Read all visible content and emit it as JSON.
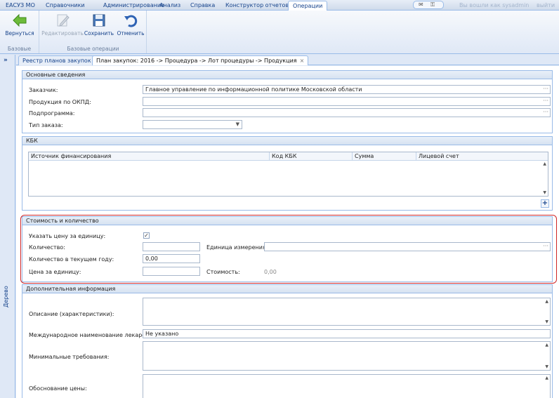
{
  "menu": {
    "items": [
      "ЕАСУЗ МО",
      "Справочники",
      "Администрирование",
      "Анализ",
      "Справка",
      "Конструктор отчетов",
      "Операции"
    ],
    "active": "Операции",
    "user_text": "Вы вошли как sysadmin",
    "logout": "выйти"
  },
  "ribbon": {
    "btn_back": "Вернуться",
    "btn_edit": "Редактировать",
    "btn_save": "Сохранить",
    "btn_cancel": "Отменить",
    "group_basic": "Базовые",
    "group_ops": "Базовые операции"
  },
  "sidebar": {
    "expand": "»",
    "label": "Дерево"
  },
  "tabs": [
    {
      "label": "Реестр планов закупок",
      "close": "×"
    },
    {
      "label": "План закупок: 2016 -> Процедура -> Лот процедуры -> Продукция",
      "close": "×"
    }
  ],
  "basic": {
    "title": "Основные сведения",
    "customer_label": "Заказчик:",
    "customer_value": "Главное управление по информационной политике Московской области",
    "okpd_label": "Продукция по ОКПД:",
    "okpd_value": "",
    "subprogram_label": "Подпрограмма:",
    "subprogram_value": "",
    "order_type_label": "Тип заказа:",
    "order_type_value": ""
  },
  "kbk": {
    "title": "КБК",
    "columns": [
      "Источник финансирования",
      "Код КБК",
      "Сумма",
      "Лицевой счет"
    ]
  },
  "cost": {
    "title": "Стоимость и количество",
    "unit_price_flag_label": "Указать цену за единицу:",
    "unit_price_flag_checked": true,
    "quantity_label": "Количество:",
    "quantity_value": "",
    "unit_label": "Единица измерения:",
    "unit_value": "",
    "qty_year_label": "Количество в текущем году:",
    "qty_year_value": "0,00",
    "price_label": "Цена за единицу:",
    "price_value": "",
    "total_label": "Стоимость:",
    "total_value": "0,00"
  },
  "extra": {
    "title": "Дополнительная информация",
    "description_label": "Описание (характеристики):",
    "description_value": "",
    "inn_label": "Международное наименование лекарства:",
    "inn_value": "Не указано",
    "requirements_label": "Минимальные требования:",
    "requirements_value": "",
    "justification_label": "Обоснование цены:",
    "justification_value": ""
  }
}
